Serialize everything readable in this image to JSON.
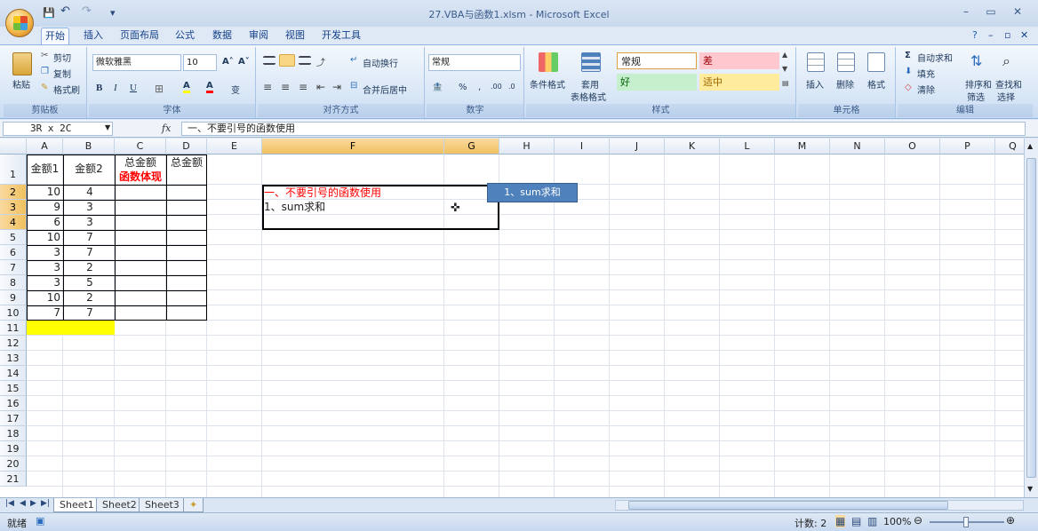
{
  "window": {
    "title": "27.VBA与函数1.xlsm - Microsoft Excel",
    "minimize": "–",
    "restore": "▭",
    "close": "✕",
    "sub_minimize": "–",
    "sub_restore": "▫",
    "sub_close": "✕",
    "help": "?"
  },
  "qat": {
    "save": "💾",
    "undo": "↶",
    "redo": "↷",
    "more": "▾"
  },
  "tabs": [
    "开始",
    "插入",
    "页面布局",
    "公式",
    "数据",
    "审阅",
    "视图",
    "开发工具"
  ],
  "ribbon": {
    "clipboard": {
      "label": "剪贴板",
      "paste": "粘贴",
      "cut": "剪切",
      "copy": "复制",
      "format_painter": "格式刷"
    },
    "font": {
      "label": "字体",
      "font_name": "微软雅黑",
      "font_size": "10",
      "grow": "A˄",
      "shrink": "A˅",
      "bold": "B",
      "italic": "I",
      "underline": "U",
      "border": "⊞",
      "fill": "A",
      "color": "A",
      "wen": "变"
    },
    "alignment": {
      "label": "对齐方式",
      "wrap": "自动换行",
      "merge": "合并后居中"
    },
    "number": {
      "label": "数字",
      "format": "常规",
      "percent": "%",
      "comma": ",",
      "inc_dec": ".00",
      "dec_dec": ".0"
    },
    "styles": {
      "label": "样式",
      "conditional": "条件格式",
      "table_line1": "套用",
      "table_line2": "表格格式",
      "normal": "常规",
      "bad": "差",
      "good": "好",
      "neutral": "适中"
    },
    "cells": {
      "label": "单元格",
      "insert": "插入",
      "delete": "删除",
      "format": "格式"
    },
    "editing": {
      "label": "编辑",
      "autosum": "自动求和",
      "fill": "填充",
      "clear": "清除",
      "sort_line1": "排序和",
      "sort_line2": "筛选",
      "find_line1": "查找和",
      "find_line2": "选择"
    }
  },
  "formula_bar": {
    "name_box": "3R x 2C",
    "fx": "fx",
    "content": "一、不要引号的函数使用"
  },
  "columns": [
    "A",
    "B",
    "C",
    "D",
    "E",
    "F",
    "G",
    "H",
    "I",
    "J",
    "K",
    "L",
    "M",
    "N",
    "O",
    "P",
    "Q"
  ],
  "rows": [
    "1",
    "2",
    "3",
    "4",
    "5",
    "6",
    "7",
    "8",
    "9",
    "10",
    "11",
    "12",
    "13",
    "14",
    "15",
    "16",
    "17",
    "18",
    "19",
    "20",
    "21"
  ],
  "cells": {
    "A1": "金额1",
    "B1": "金额2",
    "C1_line1": "总金额",
    "C1_line2": "函数体现",
    "D1": "总金额",
    "A": [
      "10",
      "9",
      "6",
      "10",
      "3",
      "3",
      "3",
      "10",
      "7"
    ],
    "B": [
      "4",
      "3",
      "3",
      "7",
      "7",
      "2",
      "5",
      "2",
      "7"
    ],
    "F2": "一、不要引号的函数使用",
    "F3": "1、sum求和"
  },
  "button": {
    "label": "1、sum求和"
  },
  "sheets": [
    "Sheet1",
    "Sheet2",
    "Sheet3"
  ],
  "status": {
    "mode": "就绪",
    "count": "计数: 2",
    "zoom": "100%"
  },
  "colors": {
    "accent": "#4f81bd",
    "red_text": "#ff0000",
    "highlight_yellow": "#ffff00",
    "bad_bg": "#ffc7ce",
    "good_bg": "#c6efce",
    "neutral_bg": "#ffeb9c"
  }
}
